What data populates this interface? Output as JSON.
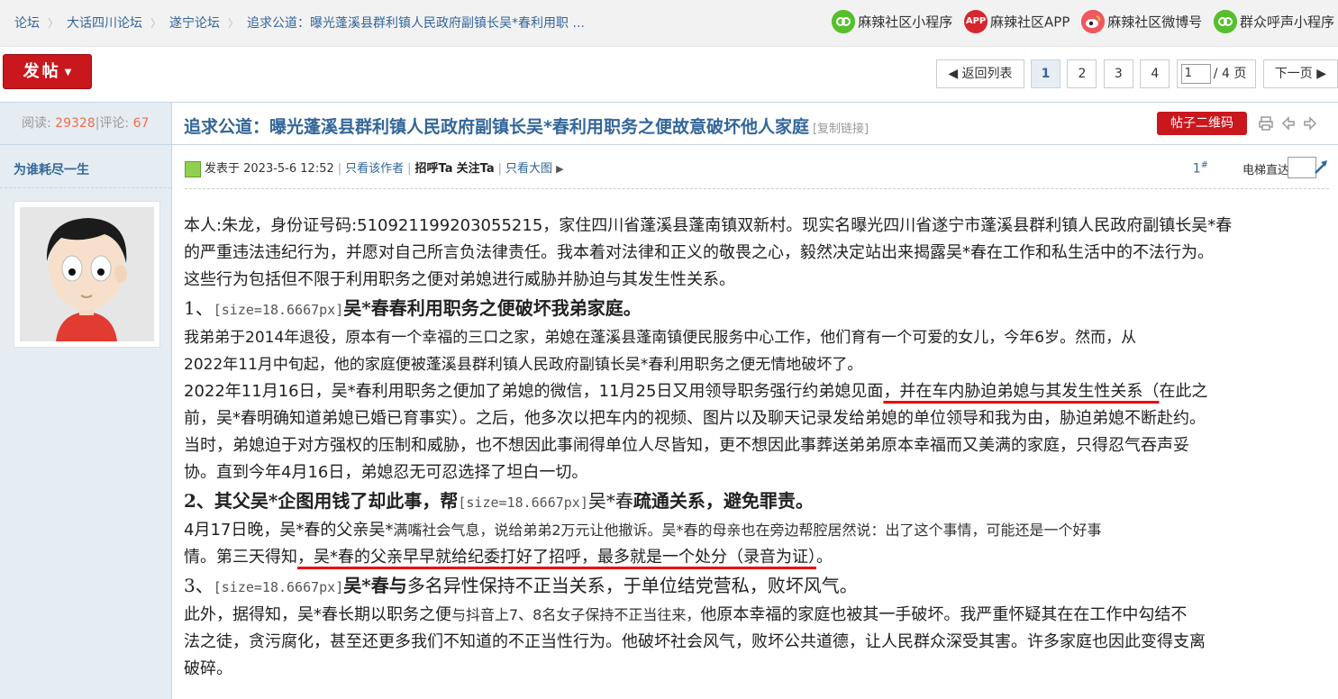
{
  "breadcrumb": {
    "items": [
      "论坛",
      "大话四川论坛",
      "遂宁论坛",
      "追求公道：曝光蓬溪县群利镇人民政府副镇长吴*春利用职 ..."
    ],
    "separator": "〉"
  },
  "app_links": [
    {
      "icon": "wechat-miniprogram-icon",
      "label": "麻辣社区小程序"
    },
    {
      "icon": "app-icon",
      "icon_text": "APP",
      "label": "麻辣社区APP"
    },
    {
      "icon": "weibo-icon",
      "label": "麻辣社区微博号"
    },
    {
      "icon": "wechat-miniprogram-icon",
      "label": "群众呼声小程序"
    }
  ],
  "toolbar": {
    "post_label": "发帖",
    "back_label": "◀ 返回列表",
    "pages": [
      "1",
      "2",
      "3",
      "4"
    ],
    "current_page": "1",
    "jump_value": "1",
    "total_pages_label": "/ 4 页",
    "next_label": "下一页 ▶"
  },
  "thread": {
    "views_label": "阅读:",
    "views": "29328",
    "replies_label": "评论:",
    "replies": "67",
    "title": "追求公道：曝光蓬溪县群利镇人民政府副镇长吴*春利用职务之便故意破坏他人家庭",
    "copy_link": "[复制链接]",
    "qr_label": "帖子二维码"
  },
  "post": {
    "author": "为谁耗尽一生",
    "posted": "发表于 2023-5-6 12:52",
    "only_author": "只看该作者",
    "greet": "招呼Ta",
    "follow": "关注Ta",
    "big_image": "只看大图",
    "floor": "1",
    "floor_mark": "#",
    "elevator_label": "电梯直达"
  },
  "content": {
    "p1": "本人:朱龙，身份证号码:510921199203055215，家住四川省蓬溪县蓬南镇双新村。现实名曝光四川省遂宁市蓬溪县群利镇人民政府副镇长吴*春",
    "p1b": "的严重违法违纪行为，并愿对自己所言负法律责任。我本着对法律和正义的敬畏之心，毅然决定站出来揭露吴*春在工作和私生活中的不法行为。",
    "p1c": "这些行为包括但不限于利用职务之便对弟媳进行威胁并胁迫与其发生性关系。",
    "h1_prefix": "1、",
    "h1_tag": "[size=18.6667px]",
    "h1_text": "吴*春春利用职务之便破坏我弟家庭。",
    "p2": "我弟弟于2014年退役，原本有一个幸福的三口之家，弟媳在蓬溪县蓬南镇便民服务中心工作，他们育有一个可爱的女儿，今年6岁。然而，从",
    "p2b": "2022年11月中旬起，他的家庭便被蓬溪县群利镇人民政府副镇长吴*春利用职务之便无情地破坏了。",
    "p3a": "2022年11月16日，吴*春利用职务之便加了弟媳的微信，11月25日又用领导职务强行约弟媳见面",
    "p3_ul": "，并在车内胁迫弟媳与其发生性关系（",
    "p3c": "在此之",
    "p3d": "前，吴*春明确知道弟媳已婚已育事实）。之后，他多次以把车内的视频、图片以及聊天记录发给弟媳的单位领导和我为由，胁迫弟媳不断赴约。",
    "p3e": "当时，弟媳迫于对方强权的压制和威胁，也不想因此事闹得单位人尽皆知，更不想因此事葬送弟弟原本幸福而又美满的家庭，只得忍气吞声妥",
    "p3f": "协。直到今年4月16日，弟媳忍无可忍选择了坦白一切。",
    "h2_prefix": "2、其父吴*企图用钱了却此事，帮",
    "h2_tag": "[size=18.6667px]",
    "h2_text": "吴*春",
    "h2_bold": "疏通关系，避免罪责。",
    "p4a": "4月17日晚，吴*春的父亲吴*",
    "p4a_light": "满嘴社会气息，说给弟弟2万元让他撤诉。吴*春的母亲也在旁边帮腔居然说：出了这个事情，可能还是一个好事",
    "p4b": "情。第三天得知",
    "p4_ul": "，吴*春的父亲早早就给纪委打好了招呼，最多就是一个处分（录音为证）",
    "p4c": "。",
    "h3_prefix": "3、",
    "h3_tag": "[size=18.6667px]",
    "h3_text": "吴*春",
    "h3_bold": "与",
    "h3_rest": "多名异性保持不正当关系，于单位结党营私，败坏风气。",
    "p5a": "此外，据得知，吴*春长期以职务之便",
    "p5a_light": "与抖音上7、8名女子保持不正当往来，",
    "p5a_rest": "他原本幸福的家庭也被其一手破坏。我严重怀疑其在在工作中勾结不",
    "p5b": "法之徒，贪污腐化，甚至还更多我们不知道的不正当性行为。他破坏社会风气，败坏公共道德，让人民群众深受其害。许多家庭也因此变得支离",
    "p5c": "破碎。"
  }
}
